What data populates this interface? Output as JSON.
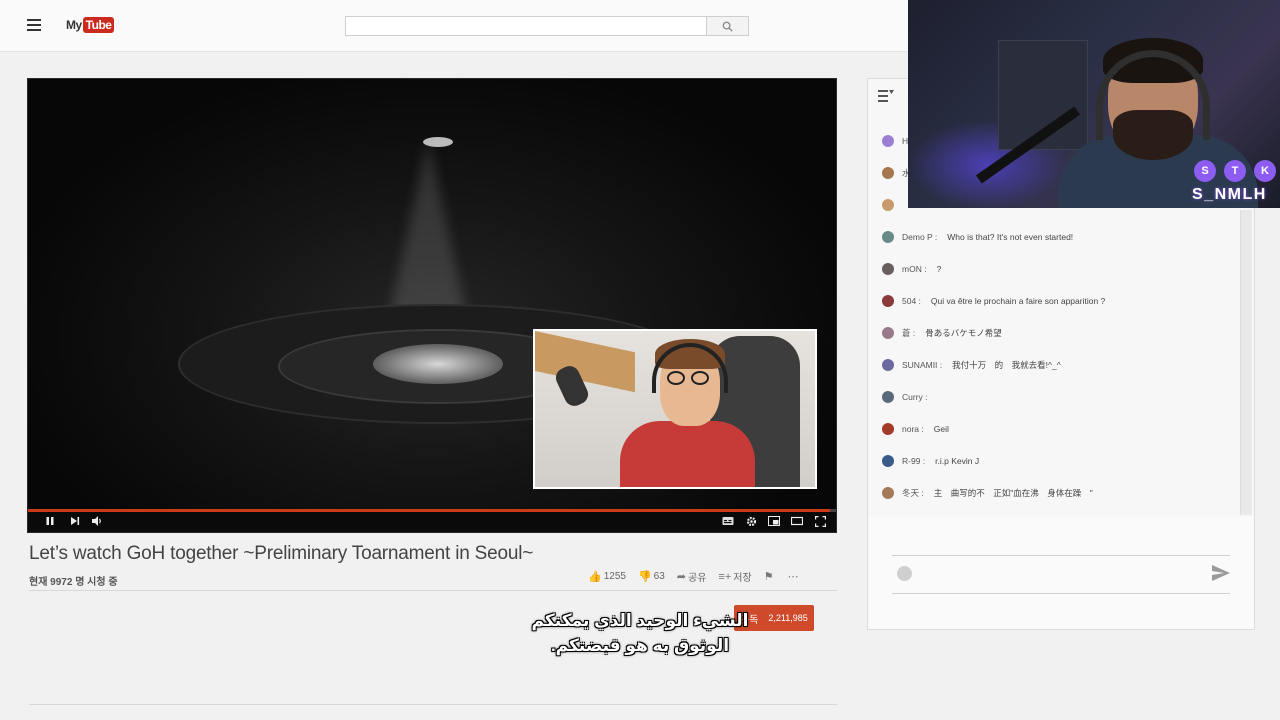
{
  "header": {
    "logo_my": "My",
    "logo_tube": "Tube",
    "search_placeholder": ""
  },
  "player": {
    "progress_fraction": 0.99,
    "state": "playing"
  },
  "video": {
    "title": "Let’s watch GoH together ~Preliminary Toarnament in Seoul~",
    "viewers": "현재 9972 명 시청 중",
    "likes": "1255",
    "dislikes": "63",
    "share_label": "공유",
    "save_label": "저장"
  },
  "subscribe": {
    "label": "구독",
    "count": "2,211,985"
  },
  "subtitle": {
    "line1": "الشيء الوحيد الذي يمكنكم",
    "line2": "الوثوق به هو قبضتكم."
  },
  "chat": {
    "messages": [
      {
        "user": "H",
        "text": "",
        "color": "#9b7fd6"
      },
      {
        "user": "水",
        "text": "",
        "color": "#a5774f"
      },
      {
        "user": "",
        "text": "",
        "color": "#c89a6a"
      },
      {
        "user": "Demo P :",
        "text": "Who is that? It's not even started!",
        "color": "#6a8a8a"
      },
      {
        "user": "mON :",
        "text": "?",
        "color": "#6a5f5f"
      },
      {
        "user": "504 :",
        "text": "Qui va être le prochain a faire son apparition ?",
        "color": "#8a3a3a"
      },
      {
        "user": "蒼 :",
        "text": "骨あるバケモノ希望",
        "color": "#9a7a8a"
      },
      {
        "user": "SUNAMII :",
        "text": "我付十万　的　我就去看!^_^",
        "color": "#6a6aa0"
      },
      {
        "user": "Curry :",
        "text": "",
        "color": "#5a6a7a"
      },
      {
        "user": "nora :",
        "text": "Geil",
        "color": "#a33a2a"
      },
      {
        "user": "R-99 :",
        "text": "r.i.p Kevin J",
        "color": "#3a5a8a"
      },
      {
        "user": "冬天 :",
        "text": "主　曲写的不　正如\"血在沸　身体在躁　\"",
        "color": "#a57a5a"
      }
    ],
    "input_placeholder": ""
  },
  "stream_overlay": {
    "handle": "S_NMLH",
    "social_icons": [
      "snapchat-icon",
      "twitch-icon",
      "kick-icon"
    ],
    "accent_color": "#8d5cf0"
  },
  "colors": {
    "accent": "#cf4a2b",
    "progress": "#cc3a1a"
  }
}
